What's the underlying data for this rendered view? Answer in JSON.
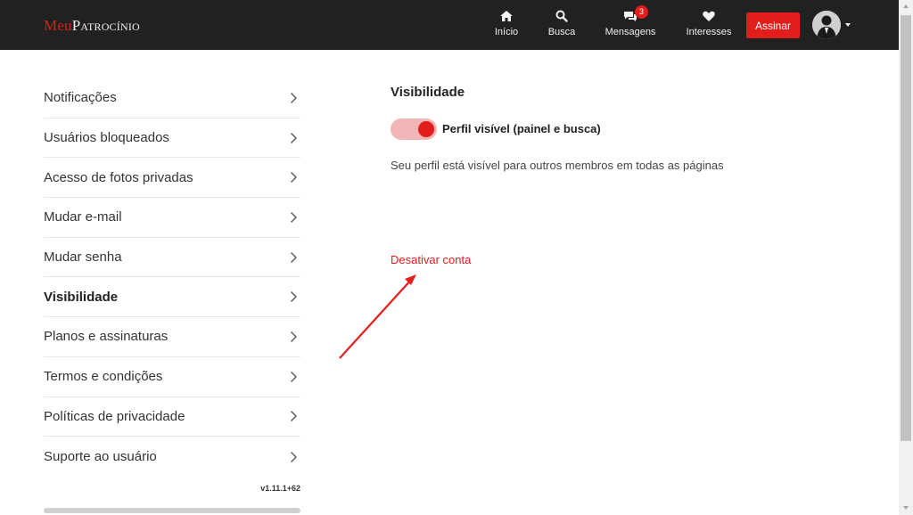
{
  "header": {
    "logo_part1": "Meu",
    "logo_part2": "Patrocínio",
    "nav": {
      "inicio": "Início",
      "busca": "Busca",
      "mensagens": "Mensagens",
      "mensagens_badge": "3",
      "interesses": "Interesses"
    },
    "subscribe_label": "Assinar"
  },
  "sidebar": {
    "items": [
      {
        "label": "Notificações"
      },
      {
        "label": "Usuários bloqueados"
      },
      {
        "label": "Acesso de fotos privadas"
      },
      {
        "label": "Mudar e-mail"
      },
      {
        "label": "Mudar senha"
      },
      {
        "label": "Visibilidade"
      },
      {
        "label": "Planos e assinaturas"
      },
      {
        "label": "Termos e condições"
      },
      {
        "label": "Políticas de privacidade"
      },
      {
        "label": "Suporte ao usuário"
      }
    ],
    "active": "Visibilidade",
    "version": "v1.11.1+62"
  },
  "main": {
    "title": "Visibilidade",
    "toggle_label": "Perfil visível (painel e busca)",
    "toggle_on": true,
    "description": "Seu perfil está visível para outros membros em todas as páginas",
    "deactivate_label": "Desativar conta"
  },
  "colors": {
    "accent": "#e31c1c",
    "topbar": "#212121",
    "toggle_track": "#f2b5b5"
  },
  "icons": [
    "home-icon",
    "search-icon",
    "chat-icon",
    "heart-icon",
    "chevron-right-icon",
    "caret-down-icon"
  ]
}
